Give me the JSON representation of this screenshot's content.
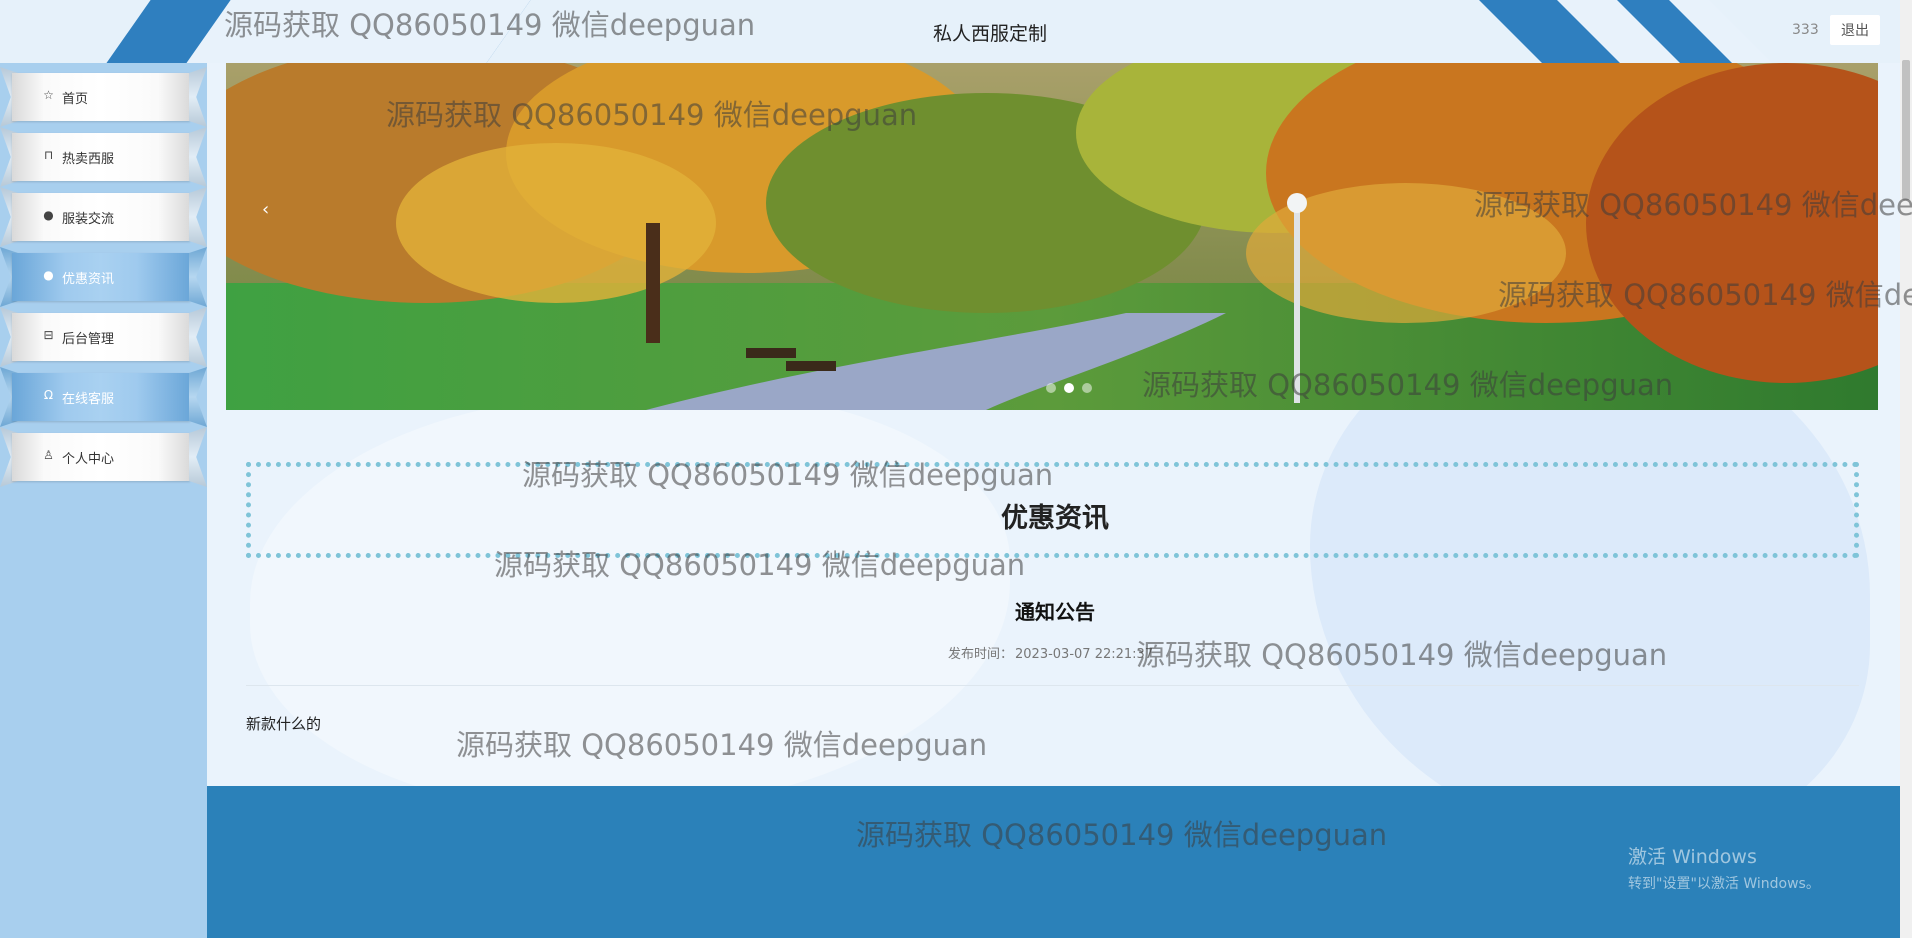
{
  "header": {
    "site_title": "私人西服定制",
    "username": "333",
    "logout_label": "退出"
  },
  "sidebar": {
    "items": [
      {
        "label": "首页",
        "icon": "star-icon"
      },
      {
        "label": "热卖西服",
        "icon": "bag-icon"
      },
      {
        "label": "服装交流",
        "icon": "info-icon"
      },
      {
        "label": "优惠资讯",
        "icon": "circle-icon"
      },
      {
        "label": "后台管理",
        "icon": "briefcase-icon"
      },
      {
        "label": "在线客服",
        "icon": "headset-icon"
      },
      {
        "label": "个人中心",
        "icon": "user-icon"
      }
    ]
  },
  "main": {
    "section_title": "优惠资讯",
    "news": {
      "title": "通知公告",
      "time_label": "发布时间：",
      "time_value": "2023-03-07 22:21:37",
      "body": "新款什么的"
    },
    "carousel": {
      "prev_icon": "chevron-left-icon",
      "dots": 3,
      "active_dot": 2
    }
  },
  "watermark_text": "源码获取 QQ86050149 微信deepguan",
  "os_watermark": {
    "line1": "激活 Windows",
    "line2": "转到\"设置\"以激活 Windows。"
  }
}
